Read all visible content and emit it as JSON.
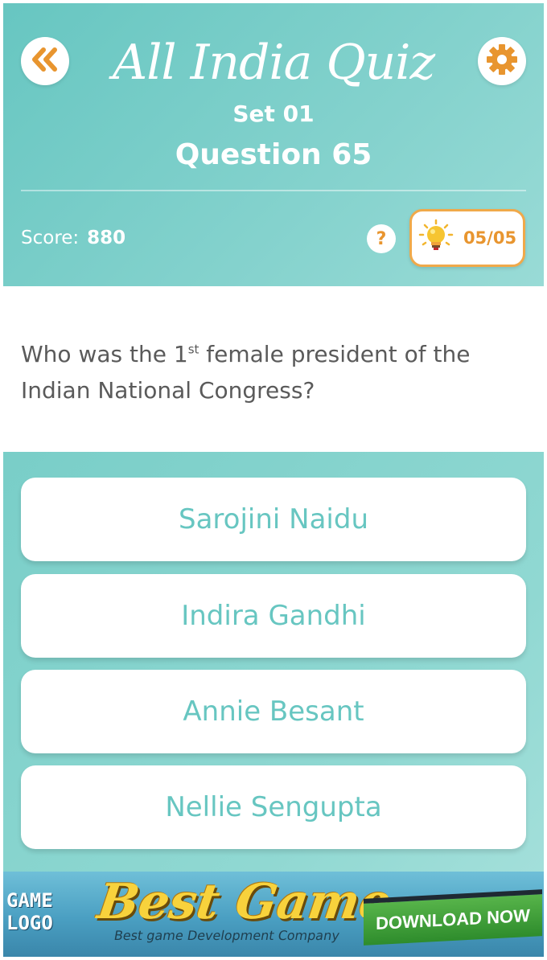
{
  "header": {
    "app_title": "All India Quiz",
    "set_label": "Set 01",
    "question_label": "Question 65",
    "score_label": "Score:",
    "score_value": "880",
    "help_label": "?",
    "hint_count": "05/05",
    "back_icon": "double-chevron-left-icon",
    "settings_icon": "gear-icon",
    "hint_icon": "lightbulb-icon"
  },
  "question": {
    "text_before": "Who was the 1",
    "superscript": "st",
    "text_after": " female president of the Indian National Congress?"
  },
  "answers": [
    {
      "label": "Sarojini Naidu"
    },
    {
      "label": "Indira Gandhi"
    },
    {
      "label": "Annie Besant"
    },
    {
      "label": "Nellie Sengupta"
    }
  ],
  "ad": {
    "logo_line1": "GAME",
    "logo_line2": "LOGO",
    "headline": "Best Game",
    "subline": "Best game Development Company",
    "cta": "DOWNLOAD NOW"
  },
  "colors": {
    "teal": "#67c6c1",
    "orange": "#e8952f",
    "question_text": "#5a5a5a"
  }
}
